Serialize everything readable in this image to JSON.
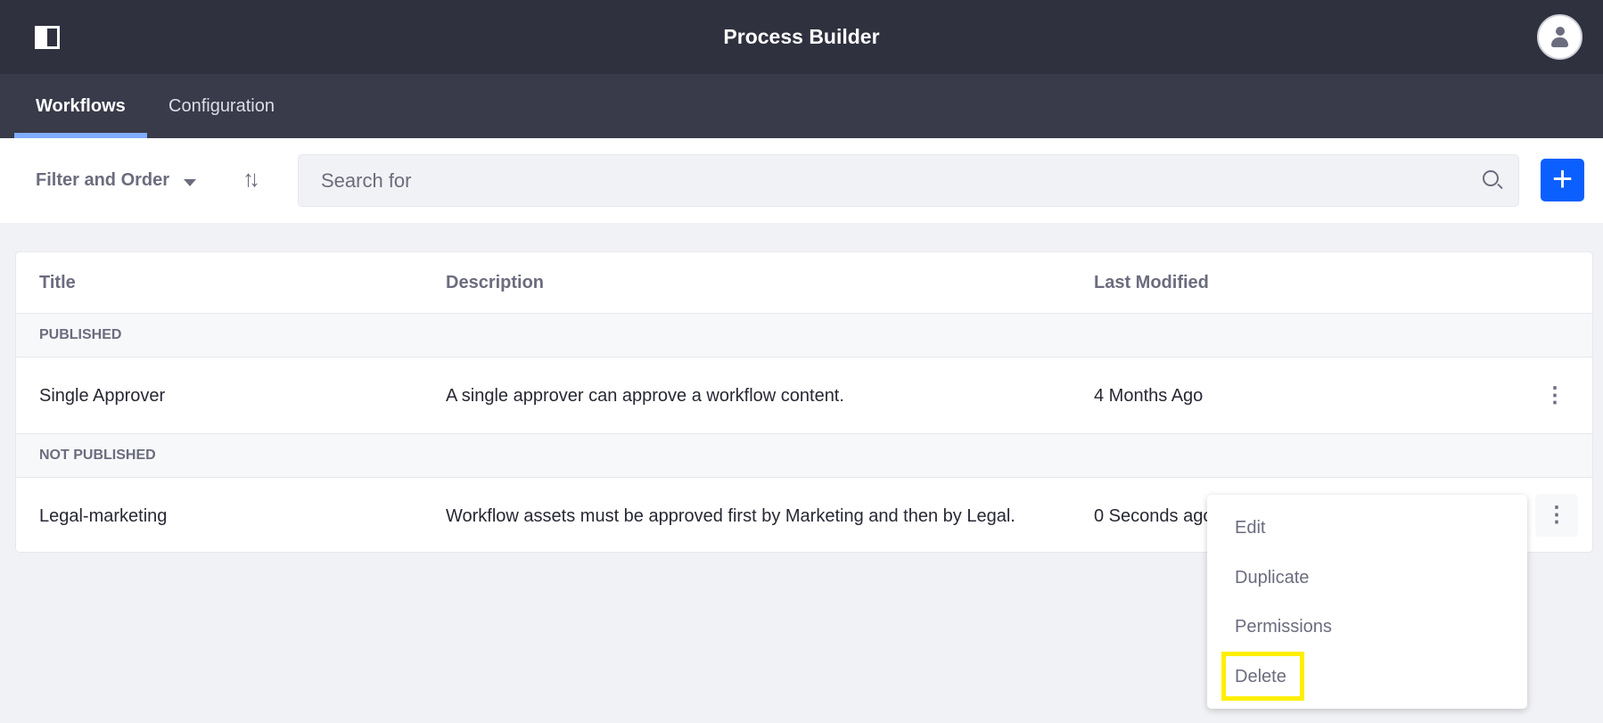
{
  "header": {
    "title": "Process Builder",
    "sidebar_toggle_icon": "sidebar-toggle-icon",
    "user_icon": "user-avatar-icon"
  },
  "tabs": [
    {
      "label": "Workflows",
      "active": true
    },
    {
      "label": "Configuration",
      "active": false
    }
  ],
  "toolbar": {
    "filter_label": "Filter and Order",
    "search_placeholder": "Search for",
    "add_button": "+",
    "accent": "#0b5fff"
  },
  "table": {
    "columns": [
      "Title",
      "Description",
      "Last Modified"
    ],
    "groups": [
      {
        "label": "PUBLISHED",
        "rows": [
          {
            "title": "Single Approver",
            "description": "A single approver can approve a workflow content.",
            "modified": "4 Months Ago"
          }
        ]
      },
      {
        "label": "NOT PUBLISHED",
        "rows": [
          {
            "title": "Legal-marketing",
            "description": "Workflow assets must be approved first by Marketing and then by Legal.",
            "modified": "0 Seconds ago"
          }
        ]
      }
    ]
  },
  "dropdown": {
    "items": [
      "Edit",
      "Duplicate",
      "Permissions",
      "Delete"
    ],
    "highlighted": "Delete",
    "highlight_color": "#ffef00"
  }
}
